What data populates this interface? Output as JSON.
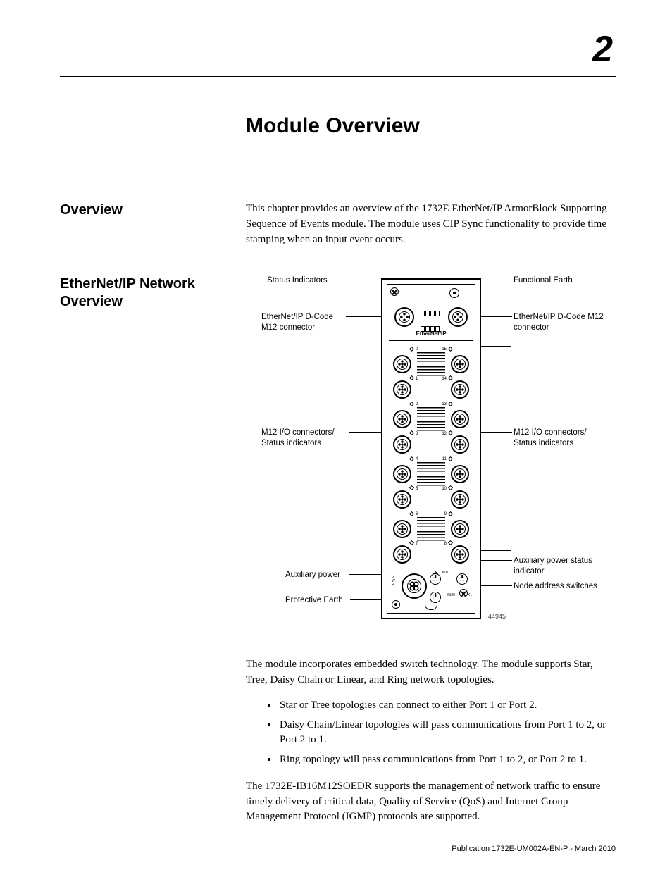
{
  "chapter_number": "2",
  "title": "Module Overview",
  "sections": {
    "overview": {
      "heading": "Overview",
      "p1": "This chapter provides an overview of the 1732E EtherNet/IP ArmorBlock Supporting Sequence of Events module. The module uses CIP Sync functionality to provide time stamping when an input event occurs."
    },
    "network": {
      "heading": "EtherNet/IP Network Overview",
      "p1": "The module incorporates embedded switch technology. The module supports Star, Tree, Daisy Chain or Linear, and Ring network topologies.",
      "bullets": [
        "Star or Tree topologies can connect to either Port 1 or Port 2.",
        "Daisy Chain/Linear topologies will pass communications from Port 1 to 2, or Port 2 to 1.",
        "Ring topology will pass communications from Port 1 to 2, or Port 2 to 1."
      ],
      "p2": "The 1732E-IB16M12SOEDR supports the management of network traffic to ensure timely delivery of critical data, Quality of Service (QoS) and Internet Group Management Protocol (IGMP) protocols are supported."
    }
  },
  "diagram": {
    "callouts": {
      "status_indicators": "Status Indicators",
      "functional_earth": "Functional Earth",
      "eth_left": "EtherNet/IP D-Code M12 connector",
      "eth_right": "EtherNet/IP D-Code M12 connector",
      "io_left": "M12 I/O connectors/ Status indicators",
      "io_right": "M12 I/O connectors/ Status indicators",
      "aux_power": "Auxiliary power",
      "aux_power_status": "Auxiliary power status indicator",
      "node_address": "Node address switches",
      "protective_earth": "Protective Earth"
    },
    "module_label": "EtherNet/IP",
    "pwr_label": "P\nW\nR",
    "rotary_labels": {
      "x100": "X100",
      "x10": "X10",
      "x1": "X1"
    },
    "port_numbers": [
      "0",
      "1",
      "2",
      "3",
      "4",
      "5",
      "6",
      "7",
      "8",
      "9",
      "10",
      "11",
      "12",
      "13",
      "14",
      "15"
    ],
    "figure_number": "44945"
  },
  "footer": "Publication 1732E-UM002A-EN-P - March 2010"
}
